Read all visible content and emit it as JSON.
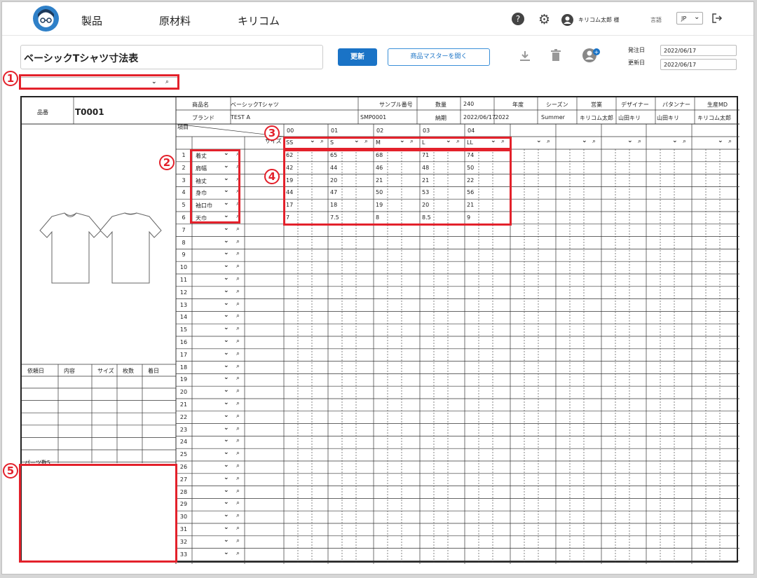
{
  "nav": {
    "items": [
      "製品",
      "原材料",
      "キリコム"
    ],
    "user": "キリコム太郎 様",
    "lang_label": "言語",
    "lang_value": "JP"
  },
  "header": {
    "title": "ベーシックTシャツ寸法表",
    "update": "更新",
    "open_master": "商品マスターを開く",
    "order_date_label": "発注日",
    "update_date_label": "更新日",
    "order_date": "2022/06/17",
    "update_date": "2022/06/17"
  },
  "callouts": [
    "1",
    "2",
    "3",
    "4",
    "5"
  ],
  "product": {
    "hinban_label": "品番",
    "hinban": "T0001",
    "name_label": "商品名",
    "name": "ベーシックTシャツ",
    "brand_label": "ブランド",
    "brand": "TEST A",
    "sample_label": "サンプル番号",
    "sample": "SMP0001",
    "qty_label": "数量",
    "qty": "240",
    "nouki_label": "納期",
    "nouki": "2022/06/17",
    "year_label": "年度",
    "year": "2022",
    "season_label": "シーズン",
    "season": "Summer",
    "sales_label": "営業",
    "sales": "キリコム太郎",
    "designer_label": "デザイナー",
    "designer": "山田キリ",
    "patterner_label": "パタンナー",
    "patterner": "山田キリ",
    "md_label": "生産MD",
    "md": "キリコム太郎"
  },
  "table": {
    "item_label": "項目",
    "size_label": "サイズ",
    "codes": [
      "00",
      "01",
      "02",
      "03",
      "04"
    ],
    "sizes": [
      "SS",
      "S",
      "M",
      "L",
      "LL"
    ],
    "items": [
      "着丈",
      "肩幅",
      "袖丈",
      "身巾",
      "袖口巾",
      "天巾"
    ],
    "values": [
      [
        "62",
        "65",
        "68",
        "71",
        "74"
      ],
      [
        "42",
        "44",
        "46",
        "48",
        "50"
      ],
      [
        "19",
        "20",
        "21",
        "21",
        "22"
      ],
      [
        "44",
        "47",
        "50",
        "53",
        "56"
      ],
      [
        "17",
        "18",
        "19",
        "20",
        "21"
      ],
      [
        "7",
        "7.5",
        "8",
        "8.5",
        "9"
      ]
    ]
  },
  "requests": {
    "headers": [
      "依頼日",
      "内容",
      "サイズ",
      "枚数",
      "着日"
    ]
  },
  "memo": "パーツ数5"
}
